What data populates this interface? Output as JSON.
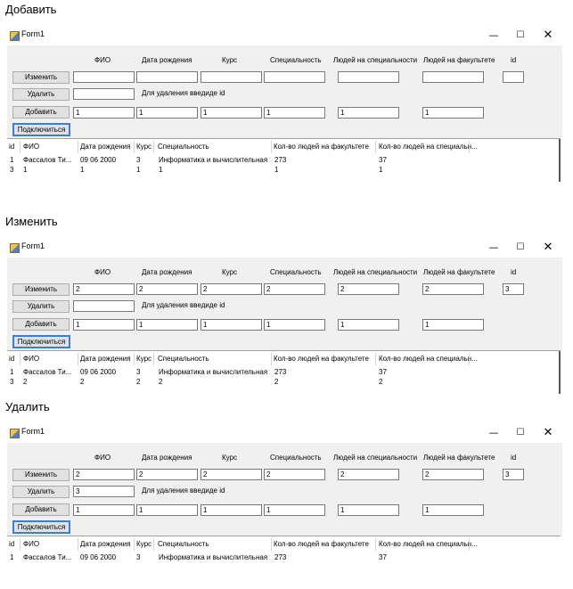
{
  "sections": [
    {
      "title": "Добавить",
      "window_title": "Form1",
      "fields": {
        "fio": "",
        "dob": "",
        "course": "",
        "spec": "",
        "people_spec": "",
        "people_fac": "",
        "id": ""
      },
      "delete_id": "",
      "add_fields": {
        "fio": "1",
        "dob": "1",
        "course": "1",
        "spec": "1",
        "people_spec": "1",
        "people_fac": "1"
      },
      "rows": [
        {
          "id": "1",
          "fio": "Фассалов Ти...",
          "dob": "09 06 2000",
          "course": "3",
          "spec": "Информатика и вычислительная т...",
          "fac": "273",
          "spc": "37"
        },
        {
          "id": "3",
          "fio": "1",
          "dob": "1",
          "course": "1",
          "spec": "1",
          "fac": "1",
          "spc": "1"
        }
      ]
    },
    {
      "title": "Изменить",
      "window_title": "Form1",
      "fields": {
        "fio": "2",
        "dob": "2",
        "course": "2",
        "spec": "2",
        "people_spec": "2",
        "people_fac": "2",
        "id": "3"
      },
      "delete_id": "",
      "add_fields": {
        "fio": "1",
        "dob": "1",
        "course": "1",
        "spec": "1",
        "people_spec": "1",
        "people_fac": "1"
      },
      "rows": [
        {
          "id": "1",
          "fio": "Фассалов Ти...",
          "dob": "09 06 2000",
          "course": "3",
          "spec": "Информатика и вычислительная т...",
          "fac": "273",
          "spc": "37"
        },
        {
          "id": "3",
          "fio": "2",
          "dob": "2",
          "course": "2",
          "spec": "2",
          "fac": "2",
          "spc": "2"
        }
      ]
    },
    {
      "title": "Удалить",
      "window_title": "Form1",
      "fields": {
        "fio": "2",
        "dob": "2",
        "course": "2",
        "spec": "2",
        "people_spec": "2",
        "people_fac": "2",
        "id": "3"
      },
      "delete_id": "3",
      "add_fields": {
        "fio": "1",
        "dob": "1",
        "course": "1",
        "spec": "1",
        "people_spec": "1",
        "people_fac": "1"
      },
      "rows": [
        {
          "id": "1",
          "fio": "Фассалов Ти...",
          "dob": "09 06 2000",
          "course": "3",
          "spec": "Информатика и вычислительная т...",
          "fac": "273",
          "spc": "37"
        }
      ]
    }
  ],
  "labels": {
    "fio": "ФИО",
    "dob": "Дата рождения",
    "course": "Курс",
    "spec": "Специальность",
    "people_spec": "Людей на специальности",
    "people_fac": "Людей на факультете",
    "id": "id",
    "delete_hint": "Для удаления введиде id"
  },
  "buttons": {
    "edit": "Изменить",
    "delete": "Удалить",
    "add": "Добавить",
    "connect": "Подключиться"
  },
  "grid_headers": {
    "id": "id",
    "fio": "ФИО",
    "dob": "Дата рождения",
    "course": "Курс",
    "spec": "Специальность",
    "fac": "Кол-во людей на факультете",
    "spc": "Кол-во людей на специальн..."
  },
  "window_controls": {
    "minimize": "—",
    "maximize": "☐",
    "close": "✕"
  },
  "colors": {
    "client_bg": "#f0f0f0",
    "default_button_border": "#3c7fd1"
  }
}
